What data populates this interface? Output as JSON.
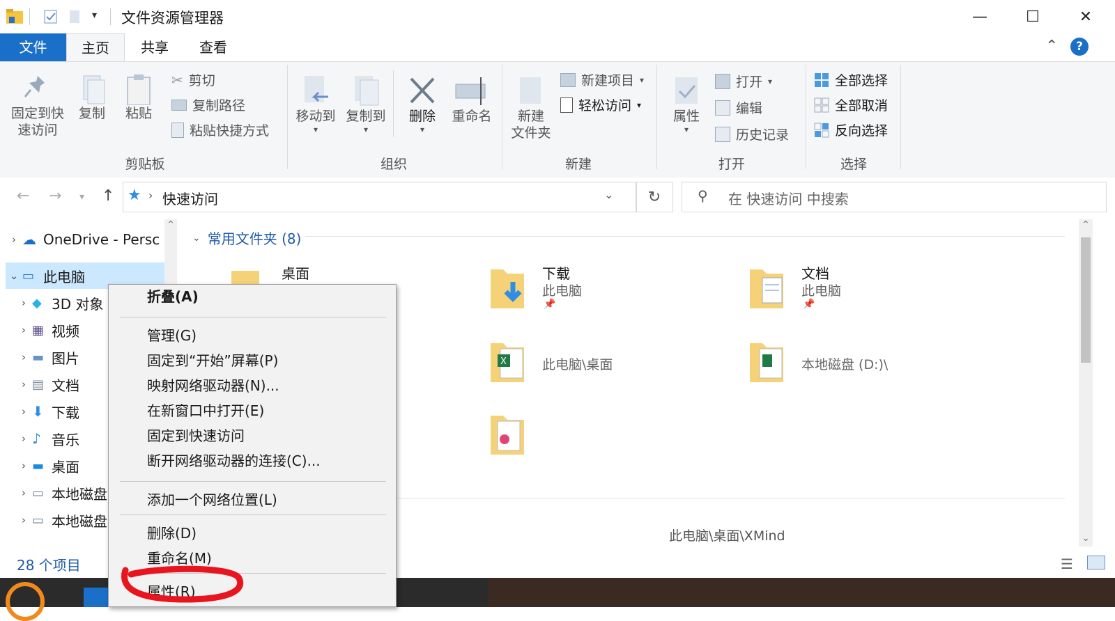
{
  "window": {
    "title": "文件资源管理器",
    "minimize_glyph": "—",
    "maximize_glyph": "☐",
    "close_glyph": "✕"
  },
  "tabs": [
    "文件",
    "主页",
    "共享",
    "查看"
  ],
  "ribbon": {
    "clipboard": {
      "pin": "固定到快速访问",
      "pin_line1": "固定到快",
      "pin_line2": "速访问",
      "copy": "复制",
      "paste": "粘贴",
      "cut": "剪切",
      "copy_path": "复制路径",
      "paste_shortcut": "粘贴快捷方式",
      "group": "剪贴板"
    },
    "organize": {
      "move_to": "移动到",
      "copy_to": "复制到",
      "delete": "删除",
      "rename": "重命名",
      "group": "组织"
    },
    "new": {
      "new_folder_line1": "新建",
      "new_folder_line2": "文件夹",
      "new_item": "新建项目",
      "easy_access": "轻松访问",
      "group": "新建"
    },
    "open": {
      "properties": "属性",
      "open": "打开",
      "edit": "编辑",
      "history": "历史记录",
      "group": "打开"
    },
    "select": {
      "select_all": "全部选择",
      "select_none": "全部取消",
      "invert": "反向选择",
      "group": "选择"
    }
  },
  "address": {
    "path": "快速访问",
    "search_placeholder": "在 快速访问 中搜索"
  },
  "nav_tree": [
    {
      "label": "OneDrive - Persc",
      "icon": "cloud-icon"
    },
    {
      "label": "此电脑",
      "icon": "computer-icon"
    },
    {
      "label": "3D 对象",
      "icon": "cube-icon"
    },
    {
      "label": "视频",
      "icon": "video-icon"
    },
    {
      "label": "图片",
      "icon": "picture-icon"
    },
    {
      "label": "文档",
      "icon": "document-icon"
    },
    {
      "label": "下载",
      "icon": "download-icon"
    },
    {
      "label": "音乐",
      "icon": "music-icon"
    },
    {
      "label": "桌面",
      "icon": "desktop-icon"
    },
    {
      "label": "本地磁盘",
      "icon": "drive-icon"
    },
    {
      "label": "本地磁盘",
      "icon": "drive-icon"
    }
  ],
  "main": {
    "section_title": "常用文件夹 (8)",
    "tiles": [
      {
        "name": "桌面",
        "sub": ""
      },
      {
        "name": "下载",
        "sub": "此电脑"
      },
      {
        "name": "文档",
        "sub": "此电脑"
      },
      {
        "name": "",
        "sub": "此电脑\\桌面"
      },
      {
        "name": "",
        "sub": "本地磁盘 (D:)\\"
      }
    ],
    "footer_path": "此电脑\\桌面\\XMind"
  },
  "status": {
    "count": "28 个项目"
  },
  "context_menu": {
    "items": [
      "折叠(A)",
      "管理(G)",
      "固定到“开始”屏幕(P)",
      "映射网络驱动器(N)...",
      "在新窗口中打开(E)",
      "固定到快速访问",
      "断开网络驱动器的连接(C)...",
      "添加一个网络位置(L)",
      "删除(D)",
      "重命名(M)",
      "属性(R)"
    ]
  },
  "colors": {
    "accent": "#1a6fc9",
    "selection": "#cce8ff",
    "highlight_mark": "#e8141e"
  }
}
